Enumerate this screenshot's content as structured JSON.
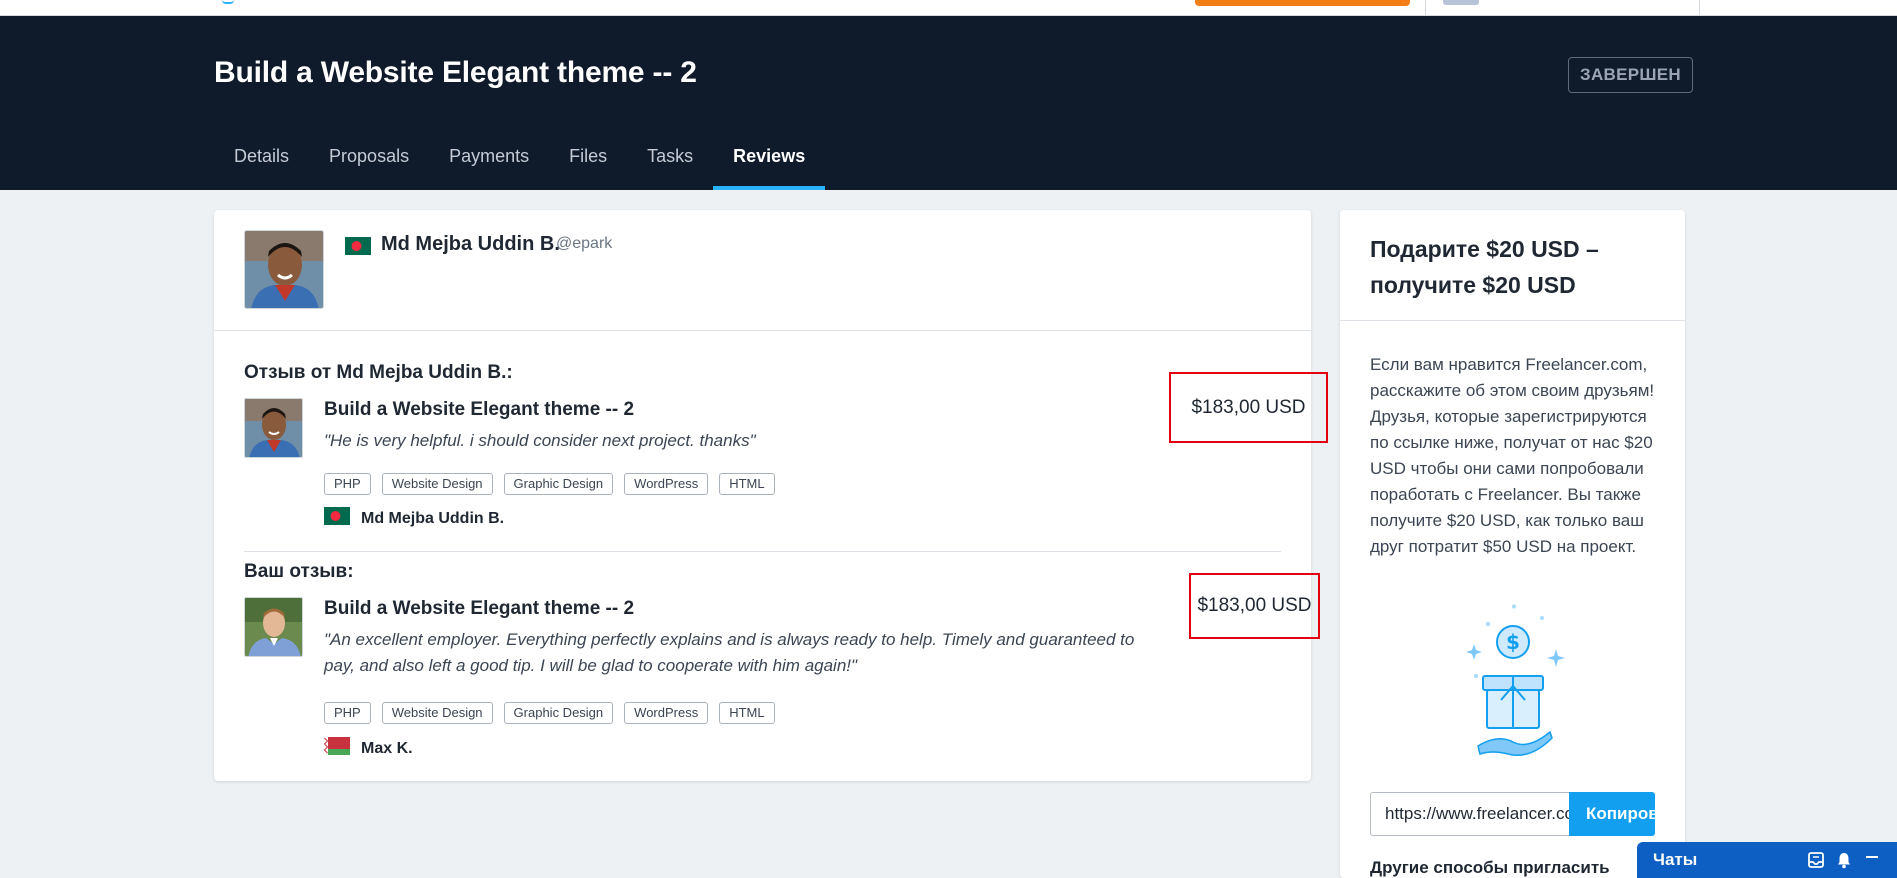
{
  "header": {
    "project_title": "Build a Website Elegant theme -- 2",
    "status_label": "ЗАВЕРШЕН",
    "tabs": [
      {
        "label": "Details"
      },
      {
        "label": "Proposals"
      },
      {
        "label": "Payments"
      },
      {
        "label": "Files"
      },
      {
        "label": "Tasks"
      },
      {
        "label": "Reviews"
      }
    ],
    "active_tab": "Reviews"
  },
  "profile": {
    "name": "Md Mejba Uddin B.",
    "handle": "@epark",
    "flag": "bangladesh-flag-icon"
  },
  "reviews": [
    {
      "heading": "Отзыв от Md Mejba Uddin B.:",
      "project_title": "Build a Website Elegant theme -- 2",
      "quote": "\"He is very helpful. i should consider next project. thanks\"",
      "tags": [
        "PHP",
        "Website Design",
        "Graphic Design",
        "WordPress",
        "HTML"
      ],
      "author": "Md Mejba Uddin B.",
      "author_flag": "bangladesh-flag-icon",
      "amount": "$183,00 USD"
    },
    {
      "heading": "Ваш отзыв:",
      "project_title": "Build a Website Elegant theme -- 2",
      "quote": "\"An excellent employer. Everything perfectly explains and is always ready to help. Timely and guaranteed to pay, and also left a good tip. I will be glad to cooperate with him again!\"",
      "tags": [
        "PHP",
        "Website Design",
        "Graphic Design",
        "WordPress",
        "HTML"
      ],
      "author": "Max K.",
      "author_flag": "belarus-flag-icon",
      "amount": "$183,00 USD"
    }
  ],
  "sidebar": {
    "title": "Подарите $20 USD – получите $20 USD",
    "body": "Если вам нравится Freelancer.com, расскажите об этом своим друзьям! Друзья, которые зарегистрируются по ссылке ниже, получат от нас $20 USD чтобы они сами попробовали поработать с Freelancer. Вы также получите $20 USD, как только ваш друг потратит $50 USD на проект.",
    "referral_url": "https://www.freelancer.com/",
    "copy_button": "Копировать",
    "more_ways": "Другие способы пригласить"
  },
  "chat": {
    "label": "Чаты"
  },
  "colors": {
    "header_bg": "#0f1a2a",
    "accent": "#29b2fe",
    "button_blue": "#139ff0",
    "highlight_red": "#e3000f"
  }
}
